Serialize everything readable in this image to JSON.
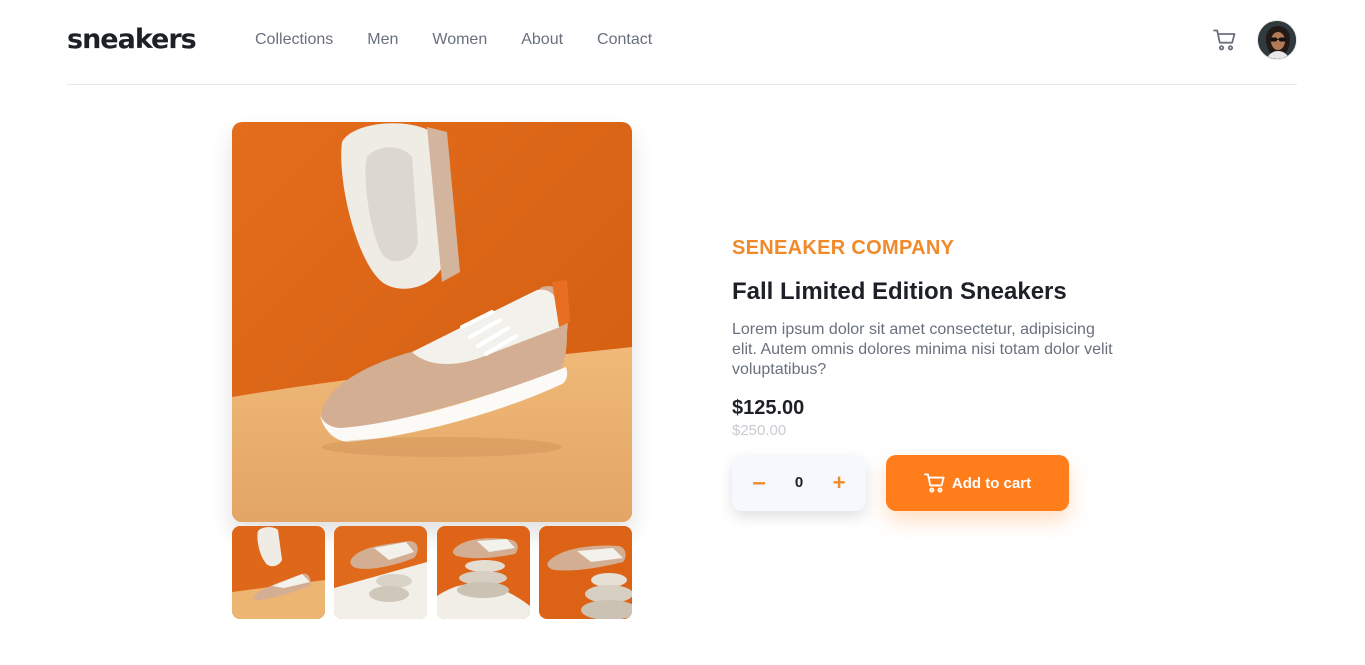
{
  "header": {
    "logo": "sneakers",
    "nav": [
      "Collections",
      "Men",
      "Women",
      "About",
      "Contact"
    ],
    "cart_icon": "cart-icon",
    "avatar_icon": "avatar"
  },
  "product": {
    "company": "SENEAKER COMPANY",
    "title": "Fall Limited Edition Sneakers",
    "description": "Lorem ipsum dolor sit amet consectetur, adipisicing elit. Autem omnis dolores minima nisi totam dolor velit voluptatibus?",
    "price": "$125.00",
    "old_price": "$250.00"
  },
  "quantity": {
    "minus": "–",
    "value": "0",
    "plus": "+"
  },
  "add_to_cart": {
    "label": "Add to cart"
  },
  "colors": {
    "accent": "#ff7e1b",
    "company": "#f08a2b",
    "text": "#1d2026",
    "muted": "#69707d",
    "strike": "#c9cbd0"
  }
}
